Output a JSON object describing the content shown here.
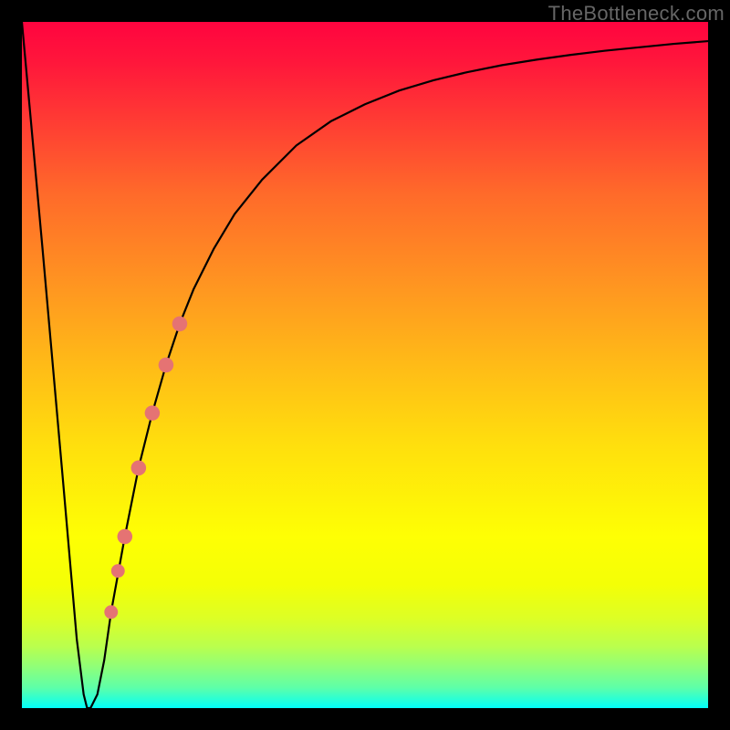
{
  "watermark": {
    "text": "TheBottleneck.com"
  },
  "chart_data": {
    "type": "line",
    "title": "",
    "xlabel": "",
    "ylabel": "",
    "xlim": [
      0,
      100
    ],
    "ylim": [
      0,
      100
    ],
    "series": [
      {
        "name": "bottleneck-curve",
        "x": [
          0,
          3,
          6,
          8,
          9,
          9.5,
          10,
          11,
          12,
          13,
          15,
          17,
          19,
          21,
          23,
          25,
          28,
          31,
          35,
          40,
          45,
          50,
          55,
          60,
          65,
          70,
          75,
          80,
          85,
          90,
          95,
          100
        ],
        "values": [
          100,
          67,
          33,
          10,
          2,
          0,
          0,
          2,
          7,
          14,
          25,
          35,
          43,
          50,
          56,
          61,
          67,
          72,
          77,
          82,
          85.5,
          88,
          90,
          91.5,
          92.7,
          93.7,
          94.5,
          95.2,
          95.8,
          96.3,
          96.8,
          97.2
        ]
      }
    ],
    "markers": [
      {
        "x": 15.0,
        "y": 25.0,
        "r": 1.0,
        "name": "segment-start"
      },
      {
        "x": 17.0,
        "y": 35.0,
        "r": 1.0,
        "name": "segment-mid1"
      },
      {
        "x": 19.0,
        "y": 43.0,
        "r": 1.0,
        "name": "segment-mid2"
      },
      {
        "x": 21.0,
        "y": 50.0,
        "r": 1.0,
        "name": "segment-mid3"
      },
      {
        "x": 23.0,
        "y": 56.0,
        "r": 1.0,
        "name": "segment-end"
      },
      {
        "x": 14.0,
        "y": 20.0,
        "r": 0.9,
        "name": "dot-lower"
      },
      {
        "x": 13.0,
        "y": 14.0,
        "r": 0.9,
        "name": "dot-lowest"
      }
    ],
    "gradient_stops": [
      {
        "pos": 0,
        "color": "#ff043f"
      },
      {
        "pos": 25,
        "color": "#ff6a2a"
      },
      {
        "pos": 50,
        "color": "#ffbb17"
      },
      {
        "pos": 75,
        "color": "#feff04"
      },
      {
        "pos": 100,
        "color": "#02fffa"
      }
    ]
  }
}
